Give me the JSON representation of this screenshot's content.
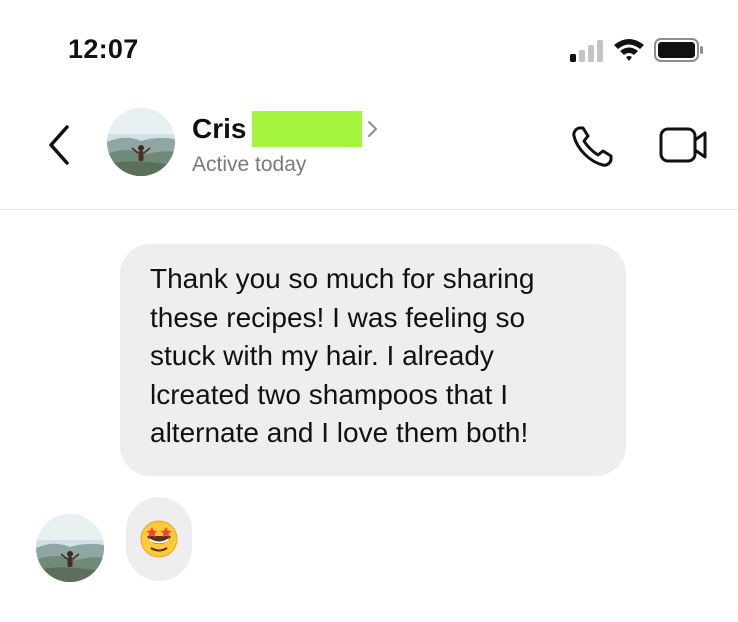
{
  "status_bar": {
    "time": "12:07",
    "icons": [
      "cellular-signal-icon",
      "wifi-icon",
      "battery-icon"
    ]
  },
  "header": {
    "contact_name": "Cris",
    "status": "Active today",
    "icons": [
      "back-chevron-icon",
      "chevron-right-icon",
      "phone-icon",
      "video-camera-icon"
    ]
  },
  "messages": [
    {
      "text": "Thank you so much for sharing\nthese recipes! I was feeling so\nstuck with my hair. I already\nlcreated two shampoos that I\nalternate and I love them both!"
    },
    {
      "emoji_icon": "star-struck-emoji-icon"
    }
  ],
  "colors": {
    "bubble": "#eeeef0",
    "redaction": "#a5f53c",
    "secondary_text": "#7a7a7a"
  }
}
